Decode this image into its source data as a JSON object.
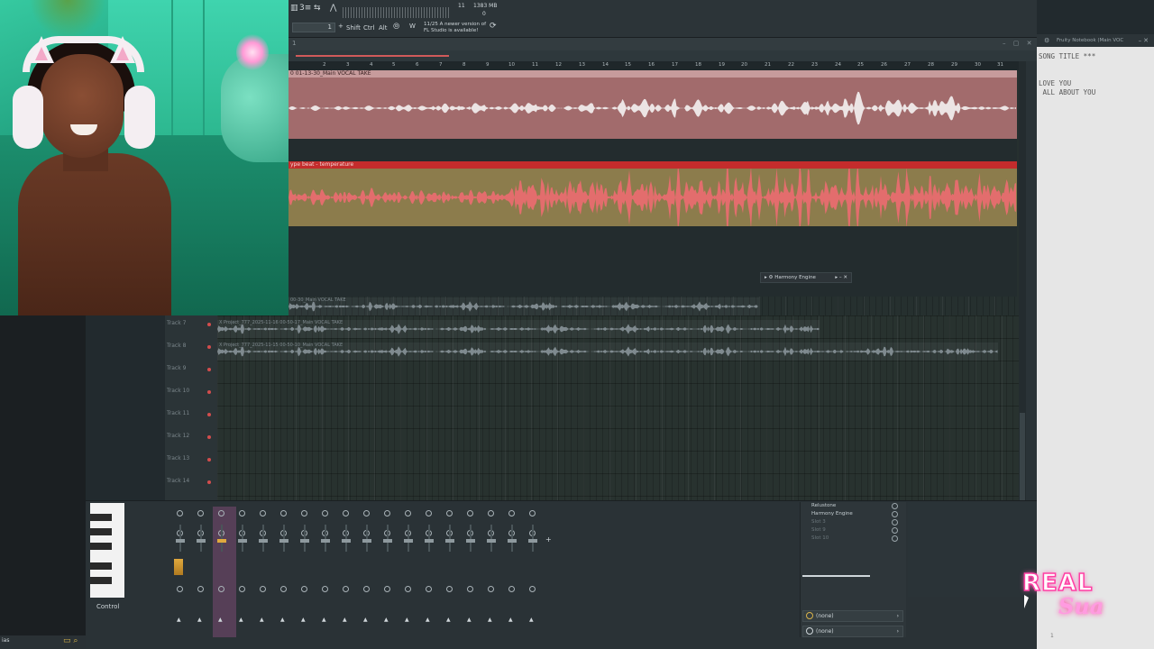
{
  "toolbar": {
    "field_value": "1",
    "shift_label": "Shift",
    "ctrl_label": "Ctrl",
    "alt_label": "Alt",
    "counter": "11",
    "memory": "1383 MB",
    "zero": "0",
    "update_notice_line1": "11/25  A newer version of",
    "update_notice_line2": "FL Studio is available!"
  },
  "playlist": {
    "pattern_number": "1",
    "ruler_ticks": [
      "2",
      "3",
      "4",
      "5",
      "6",
      "7",
      "8",
      "9",
      "10",
      "11",
      "12",
      "13",
      "14",
      "15",
      "16",
      "17",
      "18",
      "19",
      "20",
      "21",
      "22",
      "23",
      "24",
      "25",
      "26",
      "27",
      "28",
      "29",
      "30",
      "31"
    ],
    "clip_vocal_label": "0 01-13-30_Main VOCAL TAKE",
    "clip_beat_label": "ype beat - temperature",
    "ghost_clips": [
      "00-30_Main VOCAL TAKE",
      "X Project_777_2025-11-16 00-50-17_Main VOCAL TAKE",
      "X Project_777_2025-11-15 00-50-10_Main VOCAL TAKE"
    ],
    "track_headers": [
      "Track 7",
      "Track 8",
      "Track 9",
      "Track 10",
      "Track 11",
      "Track 12",
      "Track 13",
      "Track 14"
    ]
  },
  "harmony_window": {
    "title": "Harmony Engine"
  },
  "notebook": {
    "title": "Fruity Notebook (Main VOC",
    "text": "SONG TITLE ***\n\n\nLOVE YOU\n ALL ABOUT YOU",
    "footer": "1"
  },
  "mixer": {
    "control_label": "Control",
    "fx_slots": [
      {
        "name": "Relustone",
        "active": true
      },
      {
        "name": "Harmony Engine",
        "active": true
      },
      {
        "name": "Slot 3",
        "active": false
      },
      {
        "name": "Slot 9",
        "active": false
      },
      {
        "name": "Slot 10",
        "active": false
      }
    ],
    "route_in": "(none)",
    "route_out": "(none)"
  },
  "footer": {
    "left_text": "ias"
  },
  "watermark": {
    "line1": "REAL",
    "line2": "Sua"
  },
  "colors": {
    "vocal_clip": "#a26b6c",
    "beat_clip": "#8c7c4c",
    "beat_header": "#c42c2c",
    "accent": "#ff3fa4"
  }
}
